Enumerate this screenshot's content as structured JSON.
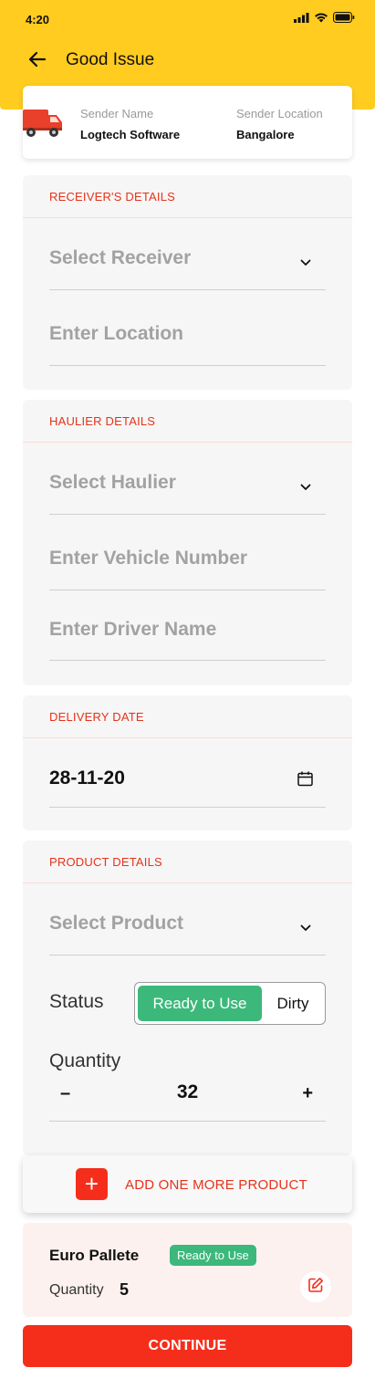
{
  "status_bar": {
    "time": "4:20"
  },
  "header": {
    "title": "Good Issue"
  },
  "sender": {
    "name_label": "Sender Name",
    "name_value": "Logtech Software",
    "location_label": "Sender Location",
    "location_value": "Bangalore"
  },
  "receiver_section": {
    "heading": "RECEIVER'S DETAILS",
    "receiver_placeholder": "Select Receiver",
    "location_placeholder": "Enter Location"
  },
  "haulier_section": {
    "heading": "HAULIER DETAILS",
    "haulier_placeholder": "Select Haulier",
    "vehicle_placeholder": "Enter Vehicle Number",
    "driver_placeholder": "Enter Driver Name"
  },
  "delivery_section": {
    "heading": "DELIVERY DATE",
    "date_value": "28-11-20"
  },
  "product_section": {
    "heading": "PRODUCT DETAILS",
    "product_placeholder": "Select Product",
    "status_label": "Status",
    "status_options": [
      "Ready to Use",
      "Dirty"
    ],
    "status_selected": "Ready to Use",
    "quantity_label": "Quantity",
    "quantity_minus": "–",
    "quantity_value": "32",
    "quantity_plus": "+"
  },
  "add_product": {
    "icon": "+",
    "label": "ADD ONE MORE PRODUCT"
  },
  "added_item": {
    "name": "Euro Pallete",
    "badge": "Ready to Use",
    "quantity_label": "Quantity",
    "quantity_value": "5"
  },
  "continue_label": "CONTINUE",
  "colors": {
    "header_bg": "#FFCC1F",
    "accent_red": "#F52E1B",
    "section_heading": "#E5331A",
    "status_green": "#3CB87B",
    "card_bg": "#F6F6F6",
    "item_card_bg": "#FDF1EF"
  },
  "icons": [
    "back-arrow-icon",
    "truck-icon",
    "chevron-down-icon",
    "calendar-icon",
    "plus-icon",
    "edit-icon",
    "signal-icon",
    "wifi-icon",
    "battery-icon"
  ]
}
